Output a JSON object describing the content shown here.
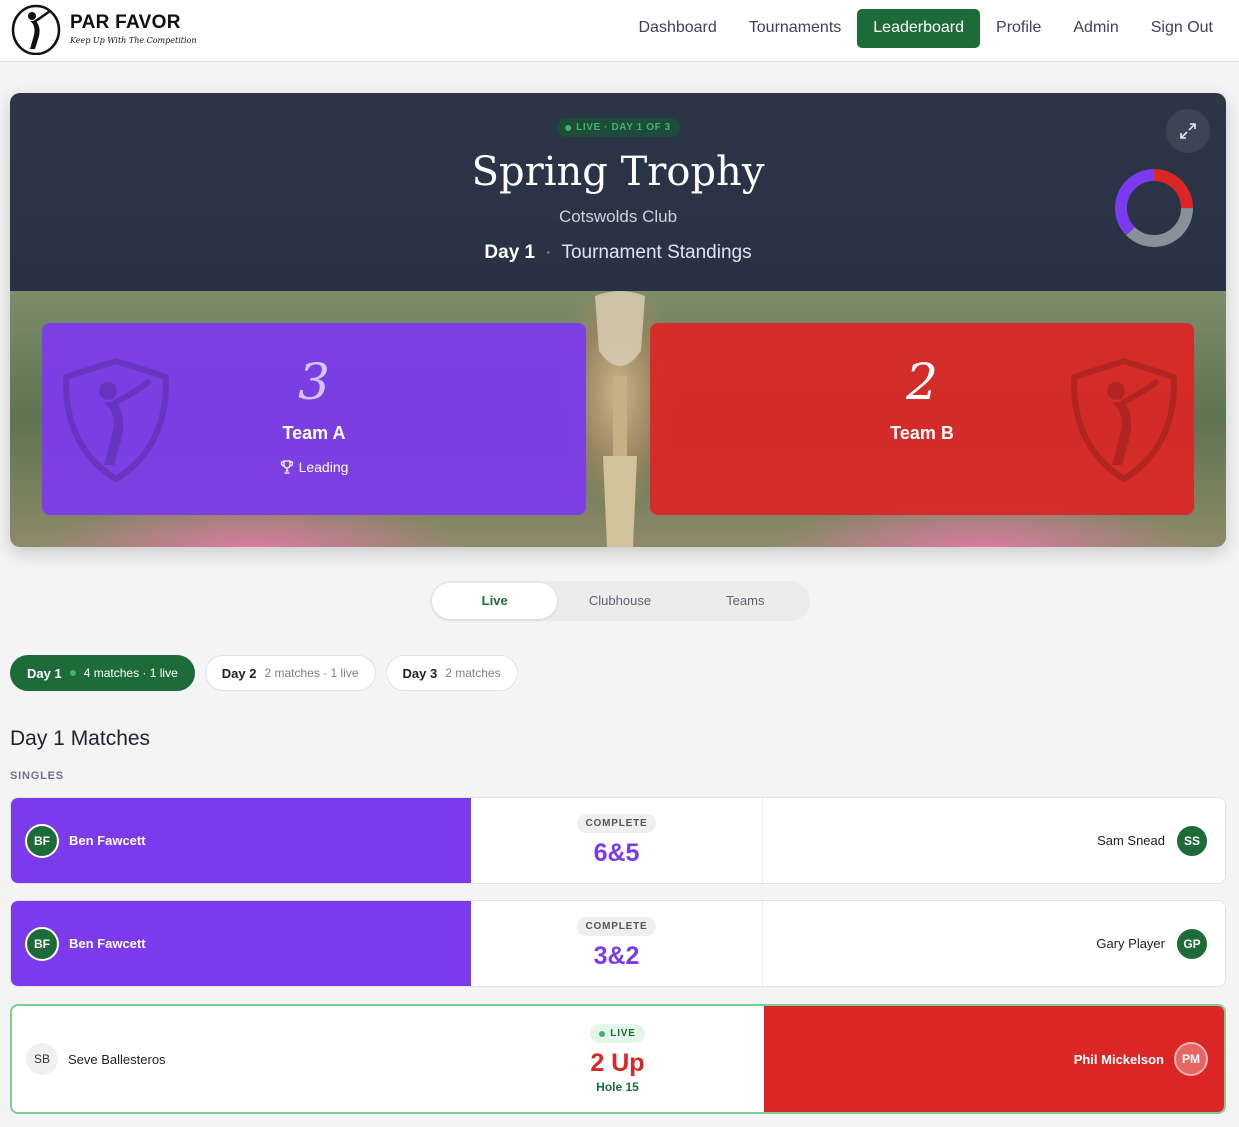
{
  "brand": {
    "name": "PAR FAVOR",
    "tagline": "Keep Up With The Competition"
  },
  "nav": [
    "Dashboard",
    "Tournaments",
    "Leaderboard",
    "Profile",
    "Admin",
    "Sign Out"
  ],
  "nav_active": "Leaderboard",
  "hero": {
    "live_label": "LIVE · DAY 1 OF 3",
    "title": "Spring Trophy",
    "club": "Cotswolds Club",
    "day": "Day 1",
    "separator": "·",
    "subtitle": "Tournament Standings",
    "donut": {
      "team_a": 3,
      "team_b": 2,
      "remaining": 3,
      "colors": {
        "team_a": "#7c3aed",
        "team_b": "#dc2626",
        "remaining": "#8a9099"
      }
    }
  },
  "teams": {
    "a": {
      "score": "3",
      "name": "Team A",
      "status": "Leading",
      "color": "#7c3aed"
    },
    "b": {
      "score": "2",
      "name": "Team B",
      "color": "#dc2626"
    }
  },
  "tabs": [
    "Live",
    "Clubhouse",
    "Teams"
  ],
  "tab_active": "Live",
  "days": [
    {
      "label": "Day 1",
      "meta": "4 matches · 1 live",
      "active": true
    },
    {
      "label": "Day 2",
      "meta": "2 matches · 1 live",
      "active": false
    },
    {
      "label": "Day 3",
      "meta": "2 matches",
      "active": false
    }
  ],
  "section": {
    "title": "Day 1 Matches",
    "format": "SINGLES"
  },
  "matches": [
    {
      "left": {
        "initials": "BF",
        "name": "Ben Fawcett"
      },
      "status": "COMPLETE",
      "result": "6&5",
      "right": {
        "name": "Sam Snead",
        "initials": "SS"
      }
    },
    {
      "left": {
        "initials": "BF",
        "name": "Ben Fawcett"
      },
      "status": "COMPLETE",
      "result": "3&2",
      "right": {
        "name": "Gary Player",
        "initials": "GP"
      }
    },
    {
      "left": {
        "initials": "SB",
        "name": "Seve Ballesteros"
      },
      "status": "LIVE",
      "result": "2 Up",
      "hole": "Hole 15",
      "right": {
        "name": "Phil Mickelson",
        "initials": "PM"
      }
    }
  ],
  "colors": {
    "primary_green": "#1d6b38",
    "hero_bg": "#2c3647",
    "live_green": "#3fb56b"
  }
}
